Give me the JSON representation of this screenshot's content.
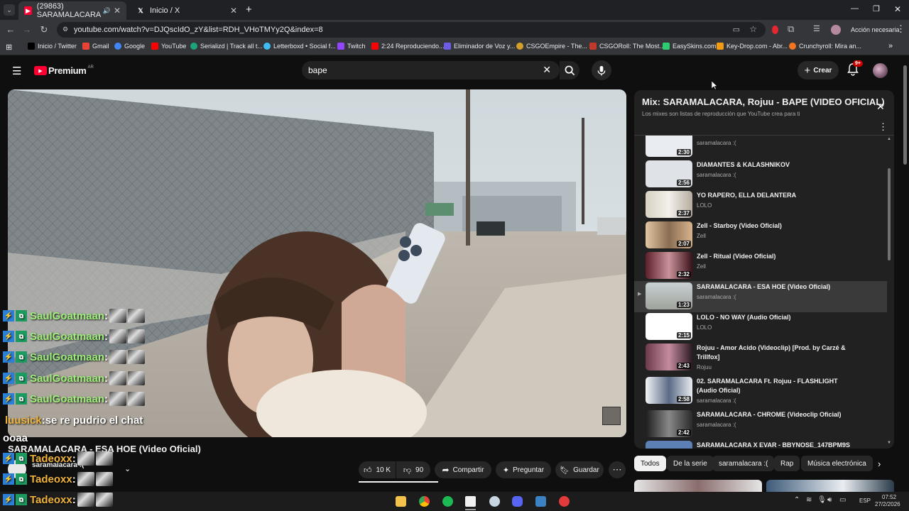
{
  "browser": {
    "tabs": [
      {
        "label": "(29863) SARAMALACARA",
        "active": true
      },
      {
        "label": "Inicio / X",
        "active": false
      }
    ],
    "url": "youtube.com/watch?v=DJQscIdO_zY&list=RDH_VHoTMYy2Q&index=8",
    "action_button": "Acción necesaria",
    "bookmarks": [
      "Inicio / Twitter",
      "Gmail",
      "Google",
      "YouTube",
      "Serializd | Track all t...",
      "Letterboxd • Social f...",
      "Twitch",
      "2:24 Reproduciendo...",
      "Eliminador de Voz y...",
      "CSGOEmpire - The...",
      "CSGORoll: The Most...",
      "EasySkins.com",
      "Key-Drop.com - Abr...",
      "Crunchyroll: Mira an..."
    ]
  },
  "youtube": {
    "logo": "Premium",
    "region": "AR",
    "search_value": "bape",
    "create_label": "Crear",
    "notif_badge": "9+"
  },
  "chat": [
    {
      "user": "SaulGoatmaan",
      "sep": " :",
      "msg": "",
      "color": "#9ff07a"
    },
    {
      "user": "SaulGoatmaan",
      "sep": " :",
      "msg": "",
      "color": "#9ff07a"
    },
    {
      "user": "SaulGoatmaan",
      "sep": " :",
      "msg": "",
      "color": "#9ff07a"
    },
    {
      "user": "SaulGoatmaan",
      "sep": " :",
      "msg": "",
      "color": "#9ff07a"
    },
    {
      "user": "SaulGoatmaan",
      "sep": " :",
      "msg": "",
      "color": "#9ff07a"
    },
    {
      "user": "luusick",
      "sep": " :",
      "msg": " se re pudrio el chat",
      "color": "#f0b43a"
    },
    {
      "user": "ooaa",
      "sep": "",
      "msg": "",
      "color": "#ffffff"
    },
    {
      "user": "Tadeoxx",
      "sep": " :",
      "msg": "",
      "color": "#f0b43a"
    },
    {
      "user": "Tadeoxx",
      "sep": " :",
      "msg": "",
      "color": "#f0b43a"
    },
    {
      "user": "Tadeoxx",
      "sep": " :",
      "msg": "",
      "color": "#f0b43a"
    }
  ],
  "video": {
    "title": "SARAMALACARA - ESA HOE (Video Oficial)",
    "channel": "saramalacara :(",
    "likes": "10 K",
    "dislikes": "90",
    "share": "Compartir",
    "ask": "Preguntar",
    "save": "Guardar"
  },
  "playlist": {
    "title": "Mix: SARAMALACARA, Rojuu - BAPE (VIDEO OFICIAL)",
    "subtitle": "Los mixes son listas de reproducción que YouTube crea para ti",
    "items": [
      {
        "title": "",
        "channel": "saramalacara :(",
        "duration": "2:30"
      },
      {
        "title": "DIAMANTES & KALASHNIKOV",
        "channel": "saramalacara :(",
        "duration": "2:56"
      },
      {
        "title": "YO RAPERO, ELLA DELANTERA",
        "channel": "LOLO",
        "duration": "2:37"
      },
      {
        "title": "Zell - Starboy (Video Oficial)",
        "channel": "Zell",
        "duration": "2:07"
      },
      {
        "title": "Zell - Ritual (Video Oficial)",
        "channel": "Zell",
        "duration": "2:32"
      },
      {
        "title": "SARAMALACARA - ESA HOE (Video Oficial)",
        "channel": "saramalacara :(",
        "duration": "1:23",
        "current": true
      },
      {
        "title": "LOLO - NO WAY (Audio Oficial)",
        "channel": "LOLO",
        "duration": "2:15"
      },
      {
        "title": "Rojuu - Amor Acido (Videoclip) [Prod. by Carzé & Trillfox]",
        "channel": "Rojuu",
        "duration": "2:43"
      },
      {
        "title": "02. SARAMALACARA Ft. Rojuu - FLASHLIGHT (Audio Oficial)",
        "channel": "saramalacara :(",
        "duration": "2:58"
      },
      {
        "title": "SARAMALACARA - CHROME (Videoclip Oficial)",
        "channel": "saramalacara :(",
        "duration": "2:42"
      },
      {
        "title": "SARAMALACARA X EVAR - BBYNOSE_147BPM9S",
        "channel": "",
        "duration": ""
      }
    ]
  },
  "chips": [
    "Todos",
    "De la serie",
    "saramalacara :(",
    "Rap",
    "Música electrónica"
  ],
  "taskbar": {
    "lang": "ESP",
    "time": "07:52",
    "date": "27/2/2026"
  }
}
